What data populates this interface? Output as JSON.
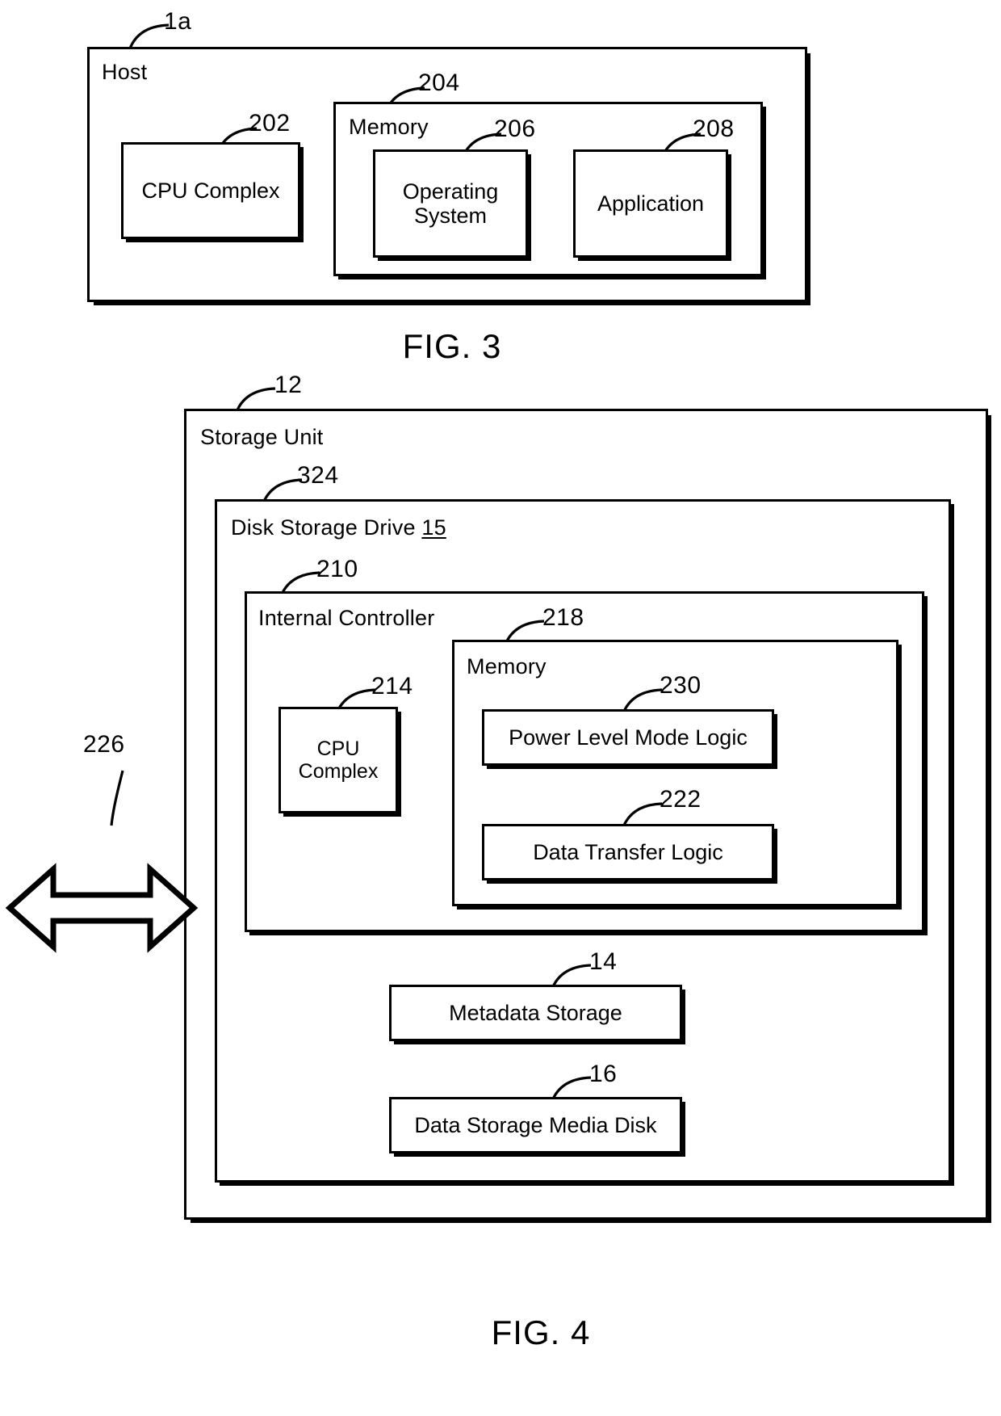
{
  "figures": [
    {
      "id": "fig3",
      "caption": "FIG. 3",
      "outer": {
        "label": "Host",
        "ref": "1a"
      },
      "cpu_complex": {
        "label": "CPU Complex",
        "ref": "202"
      },
      "memory": {
        "label": "Memory",
        "ref": "204"
      },
      "operating_system": {
        "label": "Operating\nSystem",
        "ref": "206"
      },
      "application": {
        "label": "Application",
        "ref": "208"
      }
    },
    {
      "id": "fig4",
      "caption": "FIG. 4",
      "storage_unit": {
        "label": "Storage Unit",
        "ref": "12"
      },
      "disk_storage_drive": {
        "label": "Disk Storage Drive ",
        "label_num": "15",
        "ref": "324"
      },
      "internal_controller": {
        "label": "Internal Controller",
        "ref": "210"
      },
      "cpu_complex": {
        "label": "CPU\nComplex",
        "ref": "214"
      },
      "memory": {
        "label": "Memory",
        "ref": "218"
      },
      "power_level_mode_logic": {
        "label": "Power Level Mode Logic",
        "ref": "230"
      },
      "data_transfer_logic": {
        "label": "Data Transfer Logic",
        "ref": "222"
      },
      "metadata_storage": {
        "label": "Metadata Storage",
        "ref": "14"
      },
      "data_storage_media_disk": {
        "label": "Data Storage Media Disk",
        "ref": "16"
      },
      "interface_arrow": {
        "ref": "226"
      }
    }
  ],
  "fig3": {
    "caption": "FIG. 3",
    "host_label": "Host",
    "host_ref": "1a",
    "cpu_complex_label": "CPU Complex",
    "cpu_complex_ref": "202",
    "memory_label": "Memory",
    "memory_ref": "204",
    "os_label": "Operating\nSystem",
    "os_ref": "206",
    "application_label": "Application",
    "application_ref": "208"
  },
  "fig4": {
    "caption": "FIG. 4",
    "storage_unit_label": "Storage Unit",
    "storage_unit_ref": "12",
    "disk_drive_label": "Disk Storage Drive ",
    "disk_drive_num": "15",
    "disk_drive_ref": "324",
    "internal_controller_label": "Internal Controller",
    "internal_controller_ref": "210",
    "cpu_complex_label": "CPU\nComplex",
    "cpu_complex_ref": "214",
    "memory_label": "Memory",
    "memory_ref": "218",
    "power_logic_label": "Power Level Mode Logic",
    "power_logic_ref": "230",
    "data_transfer_label": "Data Transfer Logic",
    "data_transfer_ref": "222",
    "metadata_label": "Metadata Storage",
    "metadata_ref": "14",
    "media_disk_label": "Data Storage Media Disk",
    "media_disk_ref": "16",
    "arrow_ref": "226"
  },
  "colors": {
    "ink": "#000000",
    "paper": "#ffffff"
  }
}
